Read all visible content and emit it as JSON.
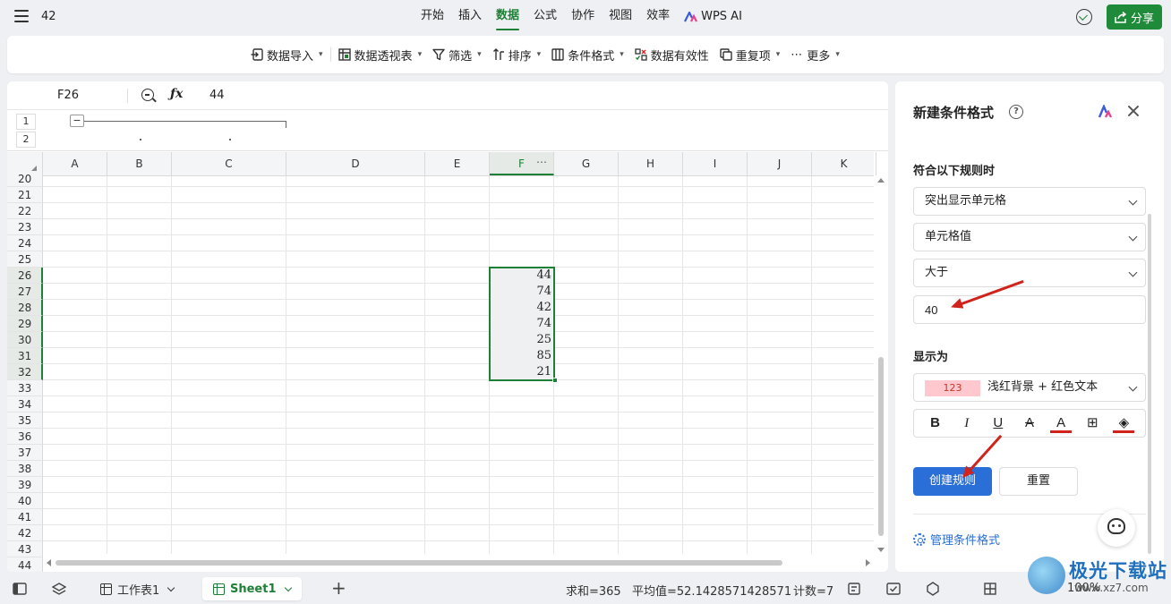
{
  "doc_name": "42",
  "main_tabs": [
    {
      "label": "开始",
      "active": false
    },
    {
      "label": "插入",
      "active": false
    },
    {
      "label": "数据",
      "active": true
    },
    {
      "label": "公式",
      "active": false
    },
    {
      "label": "协作",
      "active": false
    },
    {
      "label": "视图",
      "active": false
    },
    {
      "label": "效率",
      "active": false
    },
    {
      "label": "WPS AI",
      "active": false
    }
  ],
  "share_label": "分享",
  "toolbar": {
    "items": [
      {
        "label": "数据导入",
        "icon": "import-icon",
        "has_dropdown": true
      },
      {
        "label": "数据透视表",
        "icon": "pivot-table-icon",
        "has_dropdown": true
      },
      {
        "label": "筛选",
        "icon": "filter-icon",
        "has_dropdown": true
      },
      {
        "label": "排序",
        "icon": "sort-icon",
        "has_dropdown": true
      },
      {
        "label": "条件格式",
        "icon": "conditional-format-icon",
        "has_dropdown": true
      },
      {
        "label": "数据有效性",
        "icon": "data-validation-icon",
        "has_dropdown": false
      },
      {
        "label": "重复项",
        "icon": "duplicates-icon",
        "has_dropdown": true
      },
      {
        "label": "更多",
        "icon": "more-icon",
        "has_dropdown": true
      }
    ]
  },
  "formula_bar": {
    "cell_ref": "F26",
    "value": "44"
  },
  "outline": {
    "levels": [
      "1",
      "2"
    ],
    "collapse_symbol": "−"
  },
  "columns": [
    "A",
    "B",
    "C",
    "D",
    "E",
    "F",
    "G",
    "H",
    "I",
    "J",
    "K"
  ],
  "selected_column": "F",
  "column_more": "⋯",
  "rows": [
    "20",
    "21",
    "22",
    "23",
    "24",
    "25",
    "26",
    "27",
    "28",
    "29",
    "30",
    "31",
    "32",
    "33",
    "34",
    "35",
    "36",
    "37",
    "38",
    "39",
    "40",
    "41",
    "42",
    "43",
    "44"
  ],
  "selected_rows": [
    "26",
    "27",
    "28",
    "29",
    "30",
    "31",
    "32"
  ],
  "cells_f": [
    "44",
    "74",
    "42",
    "74",
    "25",
    "85",
    "21"
  ],
  "side_panel": {
    "title": "新建条件格式",
    "rule_label": "符合以下规则时",
    "rule_type": "突出显示单元格",
    "condition_field": "单元格值",
    "operator": "大于",
    "threshold": "40",
    "display_label": "显示为",
    "preview_sample": "123",
    "style": "浅红背景 + 红色文本",
    "format_buttons": [
      {
        "glyph": "B",
        "icon": "bold-icon"
      },
      {
        "glyph": "I",
        "icon": "italic-icon"
      },
      {
        "glyph": "U",
        "icon": "underline-icon"
      },
      {
        "glyph": "A",
        "icon": "strikethrough-icon"
      },
      {
        "glyph": "A",
        "icon": "font-color-icon"
      },
      {
        "glyph": "⊞",
        "icon": "border-icon"
      },
      {
        "glyph": "◈",
        "icon": "fill-color-icon"
      }
    ],
    "create_label": "创建规则",
    "reset_label": "重置",
    "manage_label": "管理条件格式"
  },
  "status": {
    "sheets": [
      {
        "label": "工作表1",
        "active": false
      },
      {
        "label": "Sheet1",
        "active": true
      }
    ],
    "sum": "求和=365",
    "average": "平均值=52.1428571428571",
    "count": "计数=7",
    "zoom": "100%"
  },
  "watermark": {
    "text": "极光下载站",
    "url": "www.xz7.com"
  },
  "colors": {
    "accent_green": "#1e7f37",
    "primary_blue": "#2a6ed8",
    "arrow_red": "#d0231c",
    "preview_bg": "#ffc7ce",
    "preview_text": "#c0392b"
  }
}
